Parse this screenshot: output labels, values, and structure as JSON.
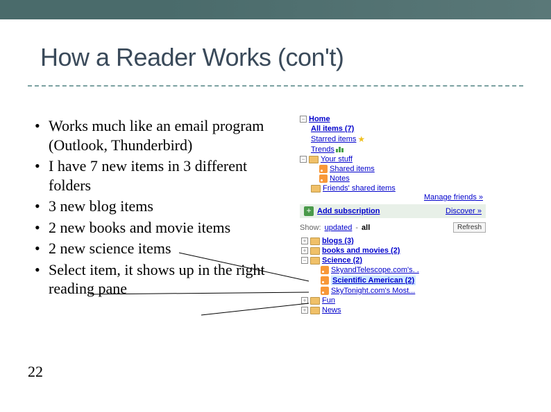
{
  "slide": {
    "title": "How a Reader Works (con't)",
    "pageNumber": "22",
    "bullets": [
      "Works much like an email program (Outlook, Thunderbird)",
      "I have 7 new items in 3 different folders",
      "3 new blog items",
      "2 new books and movie items",
      "2 new science items",
      "Select item, it shows up in the right reading pane"
    ]
  },
  "reader": {
    "home": "Home",
    "allItems": "All items (7)",
    "starred": "Starred items",
    "trends": "Trends",
    "yourStuff": "Your stuff",
    "sharedItems": "Shared items",
    "notes": "Notes",
    "friendsShared": "Friends' shared items",
    "manageFriends": "Manage friends »",
    "addSub": "Add subscription",
    "discover": "Discover »",
    "showLabel": "Show:",
    "showUpdated": "updated",
    "showAll": "all",
    "refresh": "Refresh",
    "folders": {
      "blogs": "blogs (3)",
      "books": "books and movies (2)",
      "science": "Science (2)",
      "sky": "SkyandTelescope.com's. .",
      "sciam": "Scientific American (2)",
      "skytonight": "SkyTonight.com's Most...",
      "fun": "Fun",
      "news": "News"
    }
  }
}
